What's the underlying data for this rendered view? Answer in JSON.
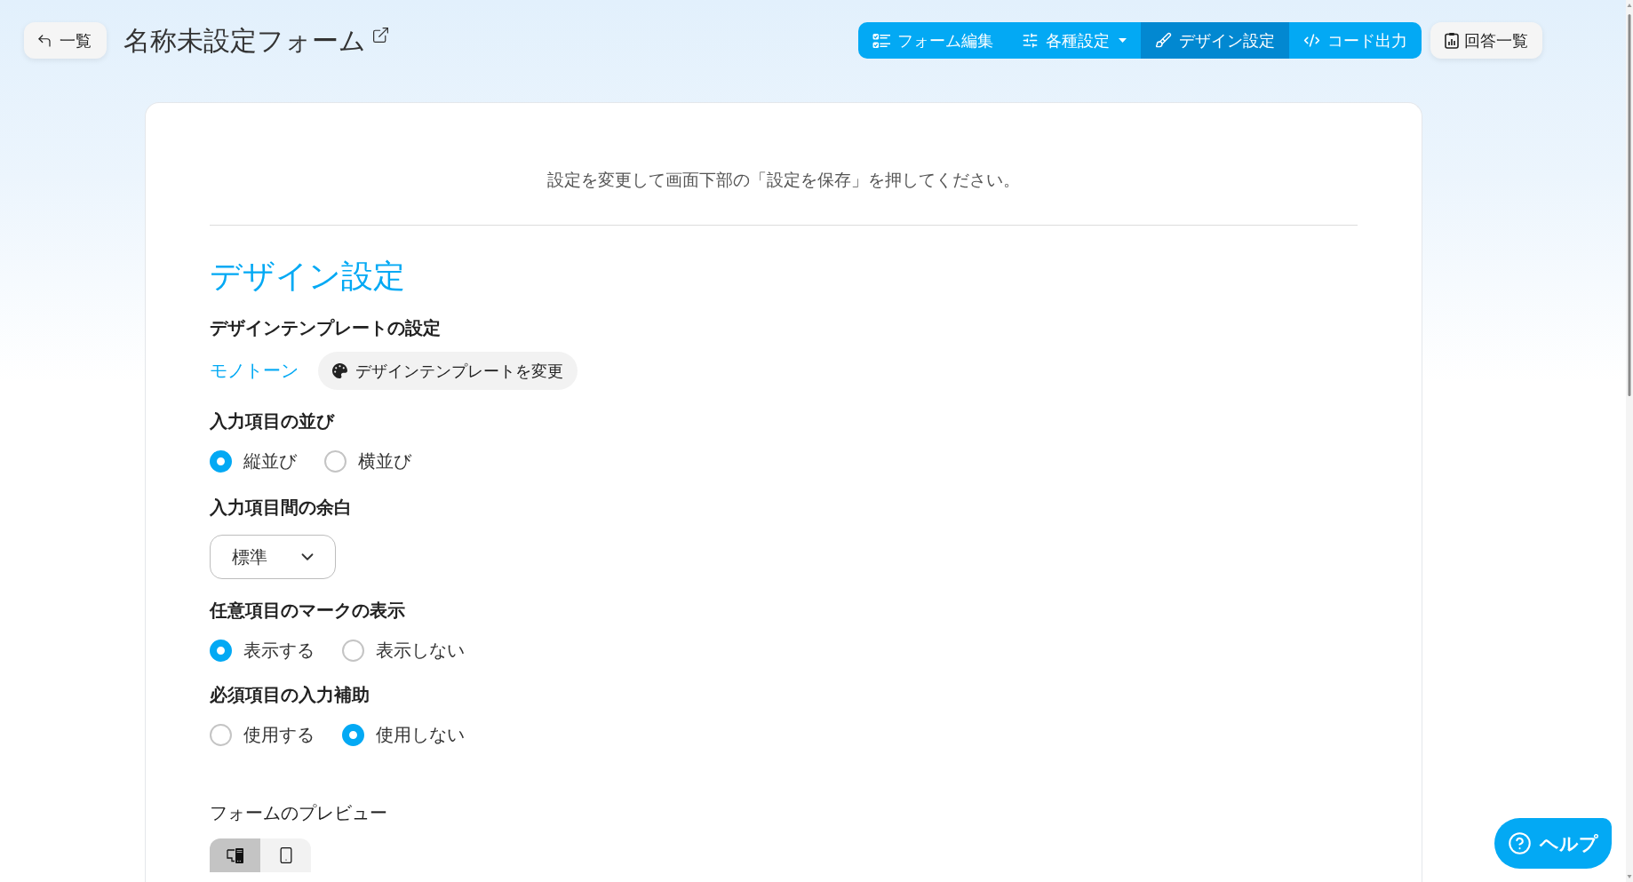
{
  "header": {
    "back_button": "一覧",
    "title": "名称未設定フォーム",
    "nav_tabs": [
      {
        "label": "フォーム編集",
        "selected": false,
        "dropdown": false
      },
      {
        "label": "各種設定",
        "selected": false,
        "dropdown": true
      },
      {
        "label": "デザイン設定",
        "selected": true,
        "dropdown": false
      },
      {
        "label": "コード出力",
        "selected": false,
        "dropdown": false
      }
    ],
    "responses_button": "回答一覧"
  },
  "card": {
    "notice": "設定を変更して画面下部の「設定を保存」を押してください。",
    "section_title": "デザイン設定",
    "settings": [
      {
        "kind": "template",
        "label": "デザインテンプレートの設定",
        "template_name": "モノトーン",
        "change_button": "デザインテンプレートを変更"
      },
      {
        "kind": "radio",
        "label": "入力項目の並び",
        "options": [
          {
            "label": "縦並び",
            "selected": true
          },
          {
            "label": "横並び",
            "selected": false
          }
        ]
      },
      {
        "kind": "select",
        "label": "入力項目間の余白",
        "value": "標準"
      },
      {
        "kind": "radio",
        "label": "任意項目のマークの表示",
        "options": [
          {
            "label": "表示する",
            "selected": true
          },
          {
            "label": "表示しない",
            "selected": false
          }
        ]
      },
      {
        "kind": "radio",
        "label": "必須項目の入力補助",
        "options": [
          {
            "label": "使用する",
            "selected": false
          },
          {
            "label": "使用しない",
            "selected": true
          }
        ]
      }
    ],
    "preview": {
      "label": "フォームのプレビュー",
      "devices": [
        {
          "selected": true
        },
        {
          "selected": false
        }
      ]
    }
  },
  "help_button": "ヘルプ"
}
